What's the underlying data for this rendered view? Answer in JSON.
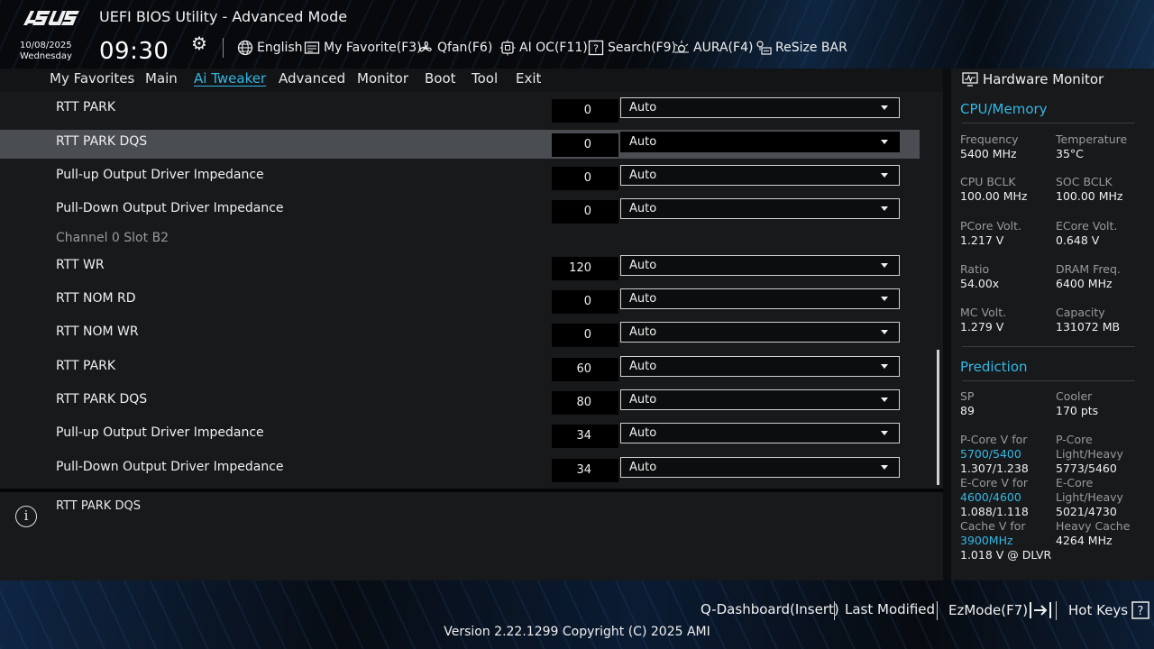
{
  "header": {
    "brand": "ASUS",
    "title": "UEFI BIOS Utility - Advanced Mode",
    "date": "10/08/2025",
    "weekday": "Wednesday",
    "time": "09:30",
    "tools": [
      {
        "label": "English",
        "icon": "globe-icon"
      },
      {
        "label": "My Favorite(F3)",
        "icon": "favorite-icon"
      },
      {
        "label": "Qfan(F6)",
        "icon": "fan-icon"
      },
      {
        "label": "AI OC(F11)",
        "icon": "ai-oc-icon"
      },
      {
        "label": "Search(F9)",
        "icon": "search-icon"
      },
      {
        "label": "AURA(F4)",
        "icon": "aura-icon"
      },
      {
        "label": "ReSize BAR",
        "icon": "resize-bar-icon"
      }
    ]
  },
  "nav": {
    "tabs": [
      "My Favorites",
      "Main",
      "Ai Tweaker",
      "Advanced",
      "Monitor",
      "Boot",
      "Tool",
      "Exit"
    ],
    "active": "Ai Tweaker"
  },
  "settings": [
    {
      "label": "RTT PARK",
      "value": "0",
      "option": "Auto"
    },
    {
      "label": "RTT PARK DQS",
      "value": "0",
      "option": "Auto"
    },
    {
      "label": "Pull-up Output Driver Impedance",
      "value": "0",
      "option": "Auto"
    },
    {
      "label": "Pull-Down Output Driver Impedance",
      "value": "0",
      "option": "Auto"
    },
    {
      "label": "Channel 0 Slot B2"
    },
    {
      "label": "RTT WR",
      "value": "120",
      "option": "Auto"
    },
    {
      "label": "RTT NOM RD",
      "value": "0",
      "option": "Auto"
    },
    {
      "label": "RTT NOM WR",
      "value": "0",
      "option": "Auto"
    },
    {
      "label": "RTT PARK",
      "value": "60",
      "option": "Auto"
    },
    {
      "label": "RTT PARK DQS",
      "value": "80",
      "option": "Auto"
    },
    {
      "label": "Pull-up Output Driver Impedance",
      "value": "34",
      "option": "Auto"
    },
    {
      "label": "Pull-Down Output Driver Impedance",
      "value": "34",
      "option": "Auto"
    }
  ],
  "info": {
    "text": "RTT PARK DQS"
  },
  "hardware_monitor": {
    "title": "Hardware Monitor",
    "cpu_memory": {
      "title": "CPU/Memory",
      "items": [
        {
          "key": "Frequency",
          "value": "5400 MHz"
        },
        {
          "key": "Temperature",
          "value": "35°C"
        },
        {
          "key": "CPU BCLK",
          "value": "100.00 MHz"
        },
        {
          "key": "SOC BCLK",
          "value": "100.00 MHz"
        },
        {
          "key": "PCore Volt.",
          "value": "1.217 V"
        },
        {
          "key": "ECore Volt.",
          "value": "0.648 V"
        },
        {
          "key": "Ratio",
          "value": "54.00x"
        },
        {
          "key": "DRAM Freq.",
          "value": "6400 MHz"
        },
        {
          "key": "MC Volt.",
          "value": "1.279 V"
        },
        {
          "key": "Capacity",
          "value": "131072 MB"
        }
      ]
    },
    "prediction": {
      "title": "Prediction",
      "sp_key": "SP",
      "sp_value": "89",
      "cooler_key": "Cooler",
      "cooler_value": "170 pts",
      "pcore_key": "P-Core V for",
      "pcore_freq": "5700/5400",
      "pcore_value": "1.307/1.238",
      "pcore_lh_key1": "P-Core",
      "pcore_lh_key2": "Light/Heavy",
      "pcore_lh_value": "5773/5460",
      "ecore_key": "E-Core V for",
      "ecore_freq": "4600/4600",
      "ecore_value": "1.088/1.118",
      "ecore_lh_key1": "E-Core",
      "ecore_lh_key2": "Light/Heavy",
      "ecore_lh_value": "5021/4730",
      "cache_key": "Cache V for",
      "cache_freq": "3900MHz",
      "cache_value": "1.018 V @ DLVR",
      "heavy_cache_key": "Heavy Cache",
      "heavy_cache_value": "4264 MHz"
    }
  },
  "footer": {
    "qdashboard": "Q-Dashboard(Insert)",
    "last_modified": "Last Modified",
    "ezmode": "EzMode(F7)",
    "hotkeys": "Hot Keys",
    "version": "Version 2.22.1299 Copyright (C) 2025 AMI"
  },
  "colors": {
    "accent": "#34b8e5",
    "selected_row": "#4a4d52",
    "panel": "#17191b"
  }
}
